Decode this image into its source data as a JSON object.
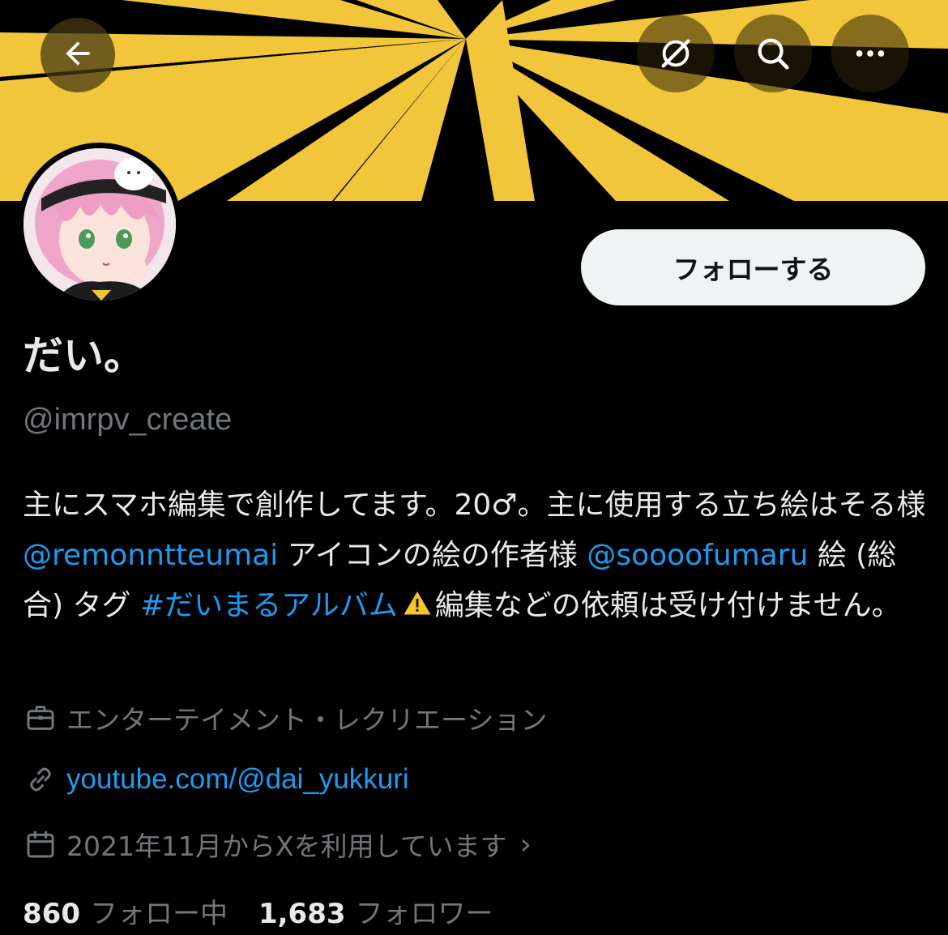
{
  "header": {
    "back_icon": "arrow-left-icon",
    "sync_icon": "sync-off-icon",
    "search_icon": "search-icon",
    "more_icon": "more-horizontal-icon"
  },
  "banner": {
    "colors": {
      "yellow": "#f2c83a",
      "black": "#000000"
    }
  },
  "profile": {
    "follow_label": "フォローする",
    "display_name": "だい。",
    "handle": "@imrpv_create"
  },
  "bio": {
    "part1": "主にスマホ編集で創作してます。20♂。主に使用する立ち絵はそる様 ",
    "mention1": "@remonntteumai",
    "part2": " アイコンの絵の作者様 ",
    "mention2": "@soooofumaru",
    "part3": " 絵 (総合) タグ ",
    "hashtag": "#だいまるアルバム",
    "part4": "編集などの依頼は受け付けません。"
  },
  "meta": {
    "category": "エンターテイメント・レクリエーション",
    "category_icon": "briefcase-icon",
    "link": "youtube.com/@dai_yukkuri",
    "link_icon": "link-icon",
    "joined": "2021年11月からXを利用しています",
    "joined_icon": "calendar-icon"
  },
  "stats": {
    "following_count": "860",
    "following_label": "フォロー中",
    "followers_count": "1,683",
    "followers_label": "フォロワー"
  },
  "colors": {
    "accent_link": "#1d9bf0",
    "muted": "#71767b",
    "text": "#e7e9ea",
    "button_bg": "#eff3f4"
  }
}
